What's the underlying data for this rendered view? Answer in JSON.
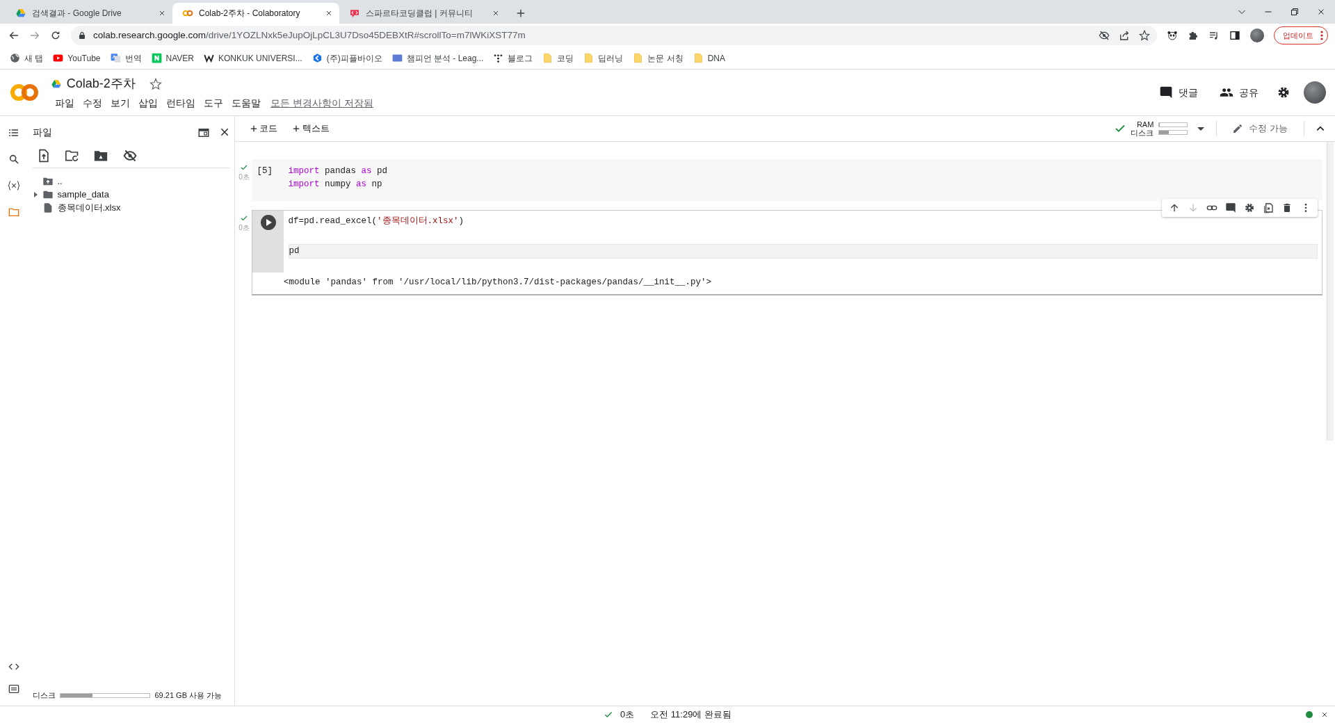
{
  "browser": {
    "tabs": [
      {
        "title": "검색결과 - Google Drive",
        "selected": false
      },
      {
        "title": "Colab-2주차 - Colaboratory",
        "selected": true
      },
      {
        "title": "스파르타코딩클럽 | 커뮤니티",
        "selected": false
      }
    ],
    "url_host": "colab.research.google.com",
    "url_path": "/drive/1YOZLNxk5eJupOjLpCL3U7Dso45DEBXtR#scrollTo=m7lWKiXST77m",
    "update_button": "업데이트",
    "bookmarks": [
      "새 탭",
      "YouTube",
      "번역",
      "NAVER",
      "KONKUK UNIVERSI...",
      "(주)피플바이오",
      "챔피언 분석 - Leag...",
      "블로그",
      "코딩",
      "딥러닝",
      "논문 서칭",
      "DNA"
    ]
  },
  "notebook": {
    "title": "Colab-2주차",
    "starred": false,
    "menus": [
      "파일",
      "수정",
      "보기",
      "삽입",
      "런타임",
      "도구",
      "도움말"
    ],
    "save_status": "모든 변경사항이 저장됨",
    "actions": [
      "댓글",
      "공유"
    ]
  },
  "toolbar": {
    "add": [
      "코드",
      "텍스트"
    ],
    "connected": true,
    "ram": {
      "label": "RAM",
      "level": 0.04
    },
    "disk": {
      "label": "디스크",
      "level": 0.35
    },
    "edit_label": "수정 가능"
  },
  "sidebar": {
    "title": "파일",
    "files": [
      {
        "kind": "parent",
        "name": ".."
      },
      {
        "kind": "folder",
        "name": "sample_data",
        "expanded": false
      },
      {
        "kind": "file",
        "name": "종목데이터.xlsx"
      }
    ],
    "disk": {
      "label": "디스크",
      "level": 0.36,
      "text": "69.21 GB 사용 가능"
    }
  },
  "cells": [
    {
      "exec_count": "[5]",
      "focused": false,
      "ran_ok": true,
      "duration": "0초",
      "lines": [
        {
          "kind": "code",
          "current": false,
          "tokens": [
            {
              "text": "import",
              "kind": "keyword"
            },
            {
              "text": " pandas ",
              "kind": "plain"
            },
            {
              "text": "as",
              "kind": "keyword"
            },
            {
              "text": " pd",
              "kind": "plain"
            }
          ]
        },
        {
          "kind": "code",
          "current": false,
          "tokens": [
            {
              "text": "import",
              "kind": "keyword"
            },
            {
              "text": " numpy ",
              "kind": "plain"
            },
            {
              "text": "as",
              "kind": "keyword"
            },
            {
              "text": " np",
              "kind": "plain"
            }
          ]
        }
      ]
    },
    {
      "focused": true,
      "ran_ok": true,
      "duration": "0초",
      "lines": [
        {
          "kind": "code",
          "current": false,
          "tokens": [
            {
              "text": "df=pd.read_excel(",
              "kind": "plain"
            },
            {
              "text": "'종목데이터.xlsx'",
              "kind": "string"
            },
            {
              "text": ")",
              "kind": "plain"
            }
          ]
        },
        {
          "kind": "blank"
        },
        {
          "kind": "code",
          "current": true,
          "tokens": [
            {
              "text": "pd",
              "kind": "plain"
            }
          ]
        }
      ],
      "output": "<module 'pandas' from '/usr/local/lib/python3.7/dist-packages/pandas/__init__.py'>",
      "cell_toolbar": [
        {
          "disabled": false
        },
        {
          "disabled": true
        },
        {
          "disabled": false
        },
        {
          "disabled": false
        },
        {
          "disabled": false
        },
        {
          "disabled": false
        },
        {
          "disabled": false
        },
        {
          "disabled": false
        }
      ]
    }
  ],
  "status": {
    "ok": true,
    "duration": "0초",
    "finished": "오전 11:29에 완료됨",
    "connected": true
  }
}
